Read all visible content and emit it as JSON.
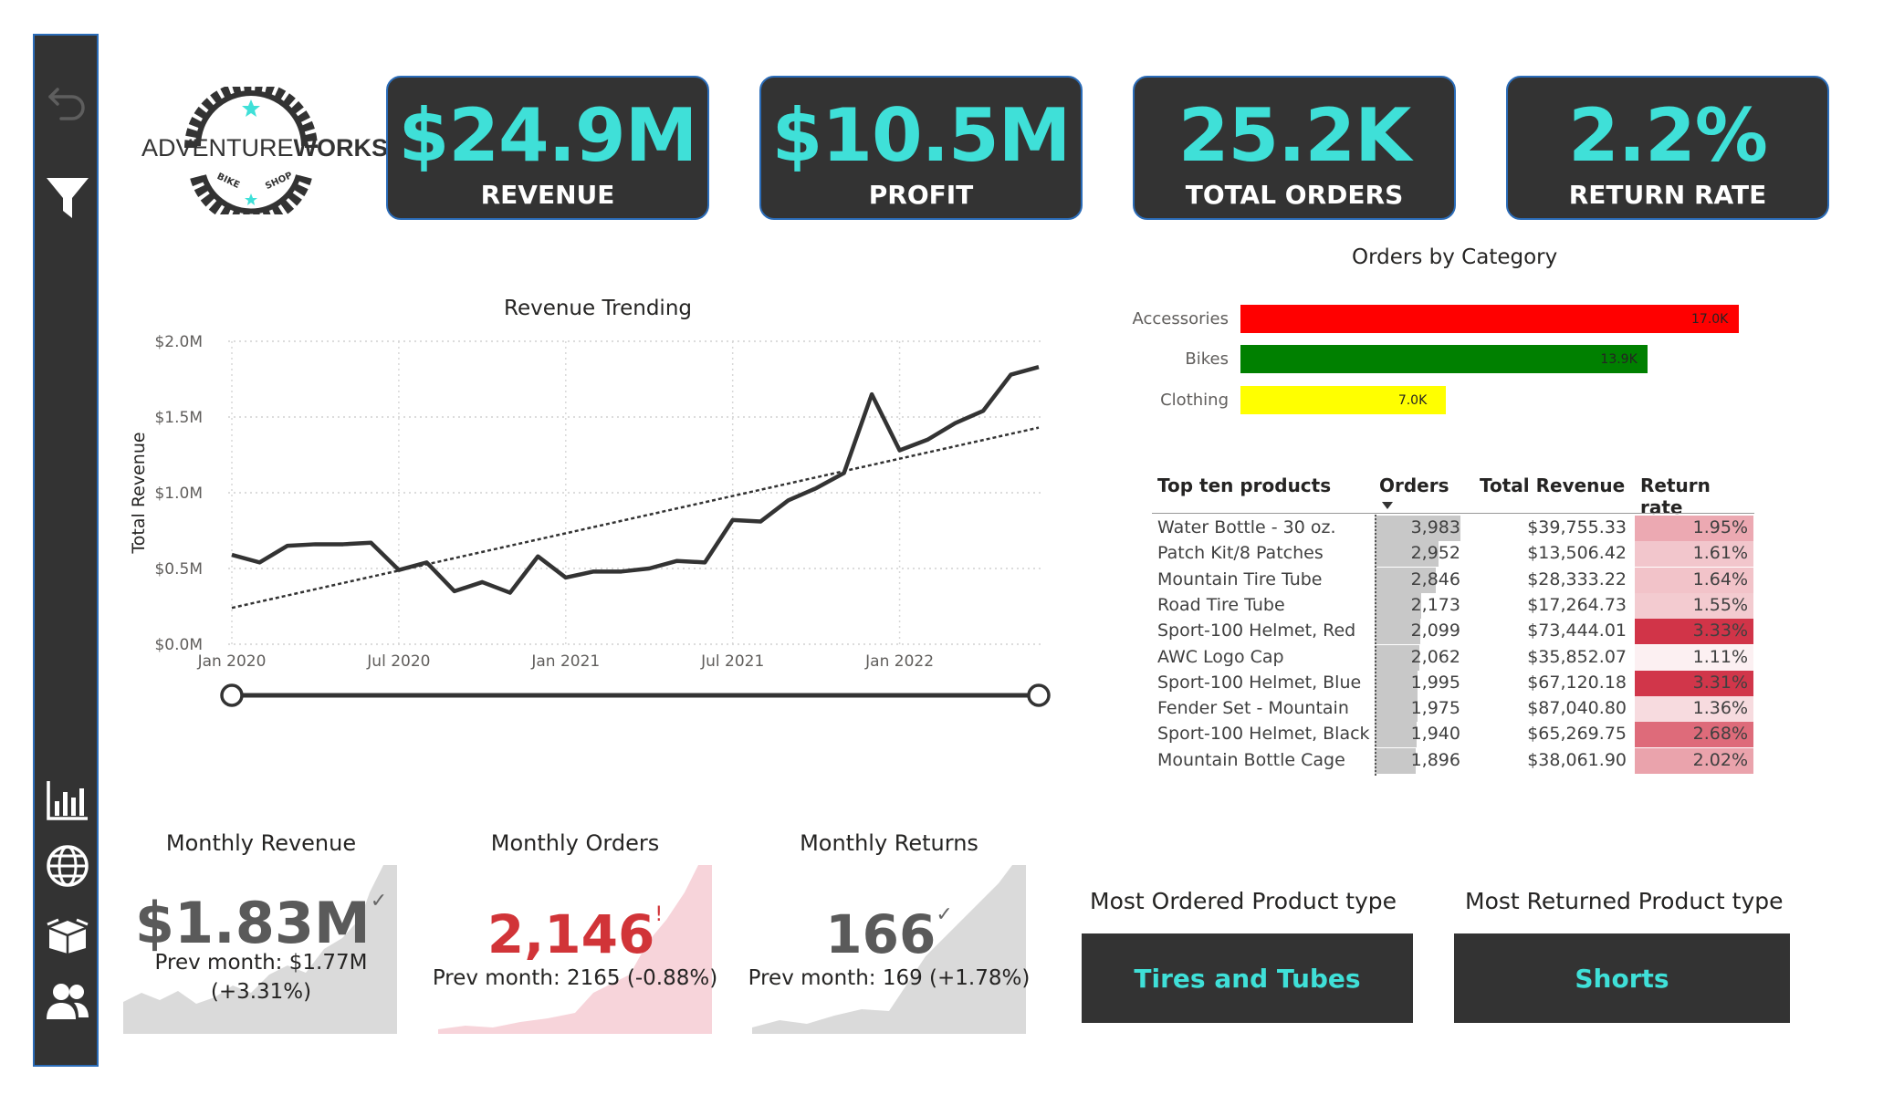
{
  "sidebar": {
    "icons": [
      "back-arrow-icon",
      "filter-icon",
      "bar-chart-icon",
      "globe-icon",
      "box-icon",
      "users-icon"
    ]
  },
  "logo": {
    "text_regular": "ADVENTURE",
    "text_bold": "WORKS",
    "badge_left": "BIKE",
    "badge_right": "SHOP"
  },
  "kpis": [
    {
      "value": "$24.9M",
      "label": "REVENUE"
    },
    {
      "value": "$10.5M",
      "label": "PROFIT"
    },
    {
      "value": "25.2K",
      "label": "TOTAL ORDERS"
    },
    {
      "value": "2.2%",
      "label": "RETURN RATE"
    }
  ],
  "colors": {
    "accent": "#3fe0d8",
    "card": "#333333",
    "card_border": "#2b6cb8",
    "accessories": "#ff0000",
    "bikes": "#008000",
    "clothing": "#ffff00",
    "alert_red": "#d13438"
  },
  "revenue_trend": {
    "title": "Revenue Trending",
    "ylabel": "Total Revenue",
    "y_ticks": [
      "$0.0M",
      "$0.5M",
      "$1.0M",
      "$1.5M",
      "$2.0M"
    ],
    "x_ticks": [
      "Jan 2020",
      "Jul 2020",
      "Jan 2021",
      "Jul 2021",
      "Jan 2022"
    ]
  },
  "chart_data": {
    "type": "line",
    "title": "Revenue Trending",
    "xlabel": "",
    "ylabel": "Total Revenue",
    "ylim": [
      0,
      2.0
    ],
    "x": [
      "2020-01",
      "2020-02",
      "2020-03",
      "2020-04",
      "2020-05",
      "2020-06",
      "2020-07",
      "2020-08",
      "2020-09",
      "2020-10",
      "2020-11",
      "2020-12",
      "2021-01",
      "2021-02",
      "2021-03",
      "2021-04",
      "2021-05",
      "2021-06",
      "2021-07",
      "2021-08",
      "2021-09",
      "2021-10",
      "2021-11",
      "2021-12",
      "2022-01",
      "2022-02",
      "2022-03",
      "2022-04",
      "2022-05",
      "2022-06"
    ],
    "series": [
      {
        "values": [
          0.59,
          0.54,
          0.65,
          0.66,
          0.66,
          0.67,
          0.49,
          0.54,
          0.35,
          0.41,
          0.34,
          0.58,
          0.44,
          0.48,
          0.48,
          0.5,
          0.55,
          0.54,
          0.82,
          0.81,
          0.95,
          1.03,
          1.13,
          1.65,
          1.28,
          1.35,
          1.46,
          1.54,
          1.78,
          1.83
        ]
      },
      {
        "style": "dashed-trend",
        "values": [
          0.24,
          1.43
        ]
      }
    ]
  },
  "orders_by_category": {
    "title": "Orders by Category",
    "items": [
      {
        "label": "Accessories",
        "value": 17.0,
        "value_label": "17.0K",
        "color": "#ff0000"
      },
      {
        "label": "Bikes",
        "value": 13.9,
        "value_label": "13.9K",
        "color": "#008000"
      },
      {
        "label": "Clothing",
        "value": 7.0,
        "value_label": "7.0K",
        "color": "#ffff00"
      }
    ]
  },
  "top_products": {
    "headers": [
      "Top ten products",
      "Orders",
      "Total Revenue",
      "Return rate"
    ],
    "rows": [
      {
        "name": "Water Bottle - 30 oz.",
        "orders": "3,983",
        "orders_n": 3983,
        "revenue": "$39,755.33",
        "rate": "1.95%",
        "rate_n": 1.95
      },
      {
        "name": "Patch Kit/8 Patches",
        "orders": "2,952",
        "orders_n": 2952,
        "revenue": "$13,506.42",
        "rate": "1.61%",
        "rate_n": 1.61
      },
      {
        "name": "Mountain Tire Tube",
        "orders": "2,846",
        "orders_n": 2846,
        "revenue": "$28,333.22",
        "rate": "1.64%",
        "rate_n": 1.64
      },
      {
        "name": "Road Tire Tube",
        "orders": "2,173",
        "orders_n": 2173,
        "revenue": "$17,264.73",
        "rate": "1.55%",
        "rate_n": 1.55
      },
      {
        "name": "Sport-100 Helmet, Red",
        "orders": "2,099",
        "orders_n": 2099,
        "revenue": "$73,444.01",
        "rate": "3.33%",
        "rate_n": 3.33
      },
      {
        "name": "AWC Logo Cap",
        "orders": "2,062",
        "orders_n": 2062,
        "revenue": "$35,852.07",
        "rate": "1.11%",
        "rate_n": 1.11
      },
      {
        "name": "Sport-100 Helmet, Blue",
        "orders": "1,995",
        "orders_n": 1995,
        "revenue": "$67,120.18",
        "rate": "3.31%",
        "rate_n": 3.31
      },
      {
        "name": "Fender Set - Mountain",
        "orders": "1,975",
        "orders_n": 1975,
        "revenue": "$87,040.80",
        "rate": "1.36%",
        "rate_n": 1.36
      },
      {
        "name": "Sport-100 Helmet, Black",
        "orders": "1,940",
        "orders_n": 1940,
        "revenue": "$65,269.75",
        "rate": "2.68%",
        "rate_n": 2.68
      },
      {
        "name": "Mountain Bottle Cage",
        "orders": "1,896",
        "orders_n": 1896,
        "revenue": "$38,061.90",
        "rate": "2.02%",
        "rate_n": 2.02
      }
    ]
  },
  "monthly": [
    {
      "title": "Monthly Revenue",
      "value": "$1.83M",
      "indicator": "✓",
      "prev_line1": "Prev month: $1.77M",
      "prev_line2": "(+3.31%)"
    },
    {
      "title": "Monthly Orders",
      "value": "2,146",
      "indicator": "!",
      "prev_line1": "Prev month: 2165 (-0.88%)",
      "prev_line2": ""
    },
    {
      "title": "Monthly Returns",
      "value": "166",
      "indicator": "✓",
      "prev_line1": "Prev month: 169 (+1.78%)",
      "prev_line2": ""
    }
  ],
  "most_ordered": {
    "title": "Most Ordered Product type",
    "value": "Tires and Tubes"
  },
  "most_returned": {
    "title": "Most Returned Product type",
    "value": "Shorts"
  }
}
